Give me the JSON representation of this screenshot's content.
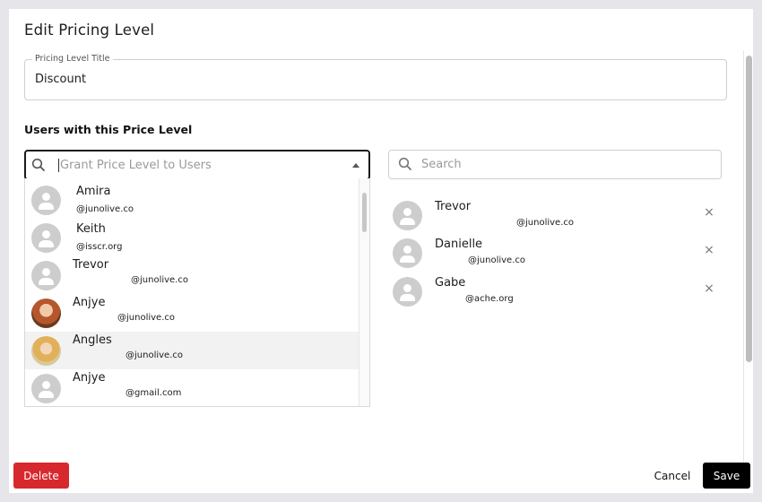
{
  "modal": {
    "title": "Edit Pricing Level",
    "field": {
      "label": "Pricing Level Title",
      "value": "Discount"
    },
    "section_label": "Users with this Price Level"
  },
  "grant": {
    "placeholder": "Grant Price Level to Users",
    "icon": "search-icon",
    "options": [
      {
        "name": "Amira",
        "email": "@junolive.co",
        "avatar": "default"
      },
      {
        "name": "Keith",
        "email": "@isscr.org",
        "avatar": "default"
      },
      {
        "name": "Trevor",
        "email": "@junolive.co",
        "avatar": "default"
      },
      {
        "name": "Anjye",
        "email": "@junolive.co",
        "avatar": "photo"
      },
      {
        "name": "Angles",
        "email": "@junolive.co",
        "avatar": "photo",
        "highlighted": true
      },
      {
        "name": "Anjye",
        "email": "@gmail.com",
        "avatar": "default"
      }
    ]
  },
  "search": {
    "placeholder": "Search",
    "icon": "search-icon"
  },
  "users": [
    {
      "name": "Trevor",
      "email": "@junolive.co",
      "remove": "×"
    },
    {
      "name": "Danielle",
      "email": "@junolive.co",
      "remove": "×"
    },
    {
      "name": "Gabe",
      "email": "@ache.org",
      "remove": "×"
    }
  ],
  "footer": {
    "delete_label": "Delete",
    "cancel_label": "Cancel",
    "save_label": "Save"
  },
  "colors": {
    "danger": "#d7282d",
    "primary": "#000000",
    "avatar_default": "#cdcdcd"
  }
}
